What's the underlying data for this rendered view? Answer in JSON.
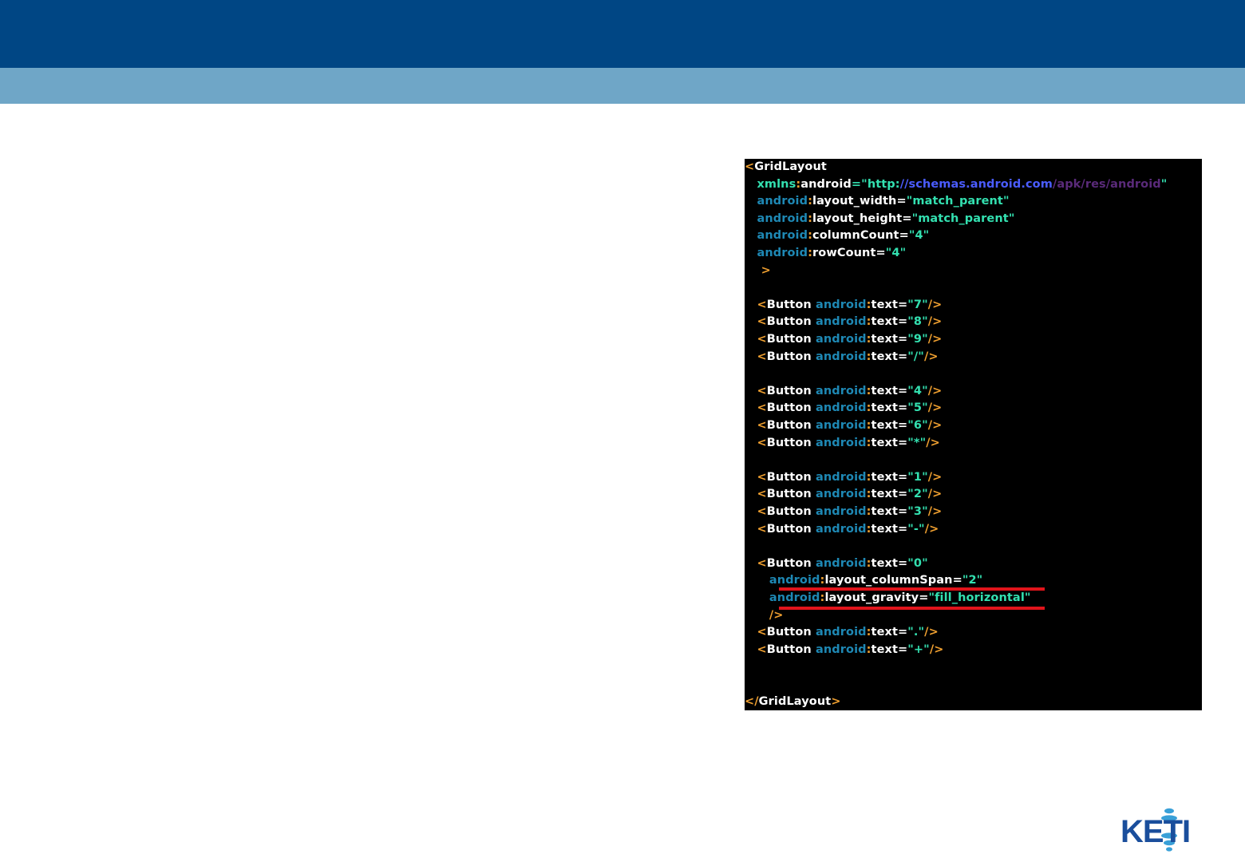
{
  "colors": {
    "header_band": "#004684",
    "sub_band": "#6fa6c7",
    "code_bg": "#000000",
    "tag_bracket": "#f0a030",
    "element_name": "#ffffff",
    "namespace": "#1e88b4",
    "attr_name": "#ffffff",
    "attr_value": "#33e0b0",
    "url_blue": "#4a5cff",
    "url_purple": "#5a2a7a",
    "highlight_underline": "#e0141b",
    "logo_blue": "#1a4e9c",
    "logo_light": "#39a0d8"
  },
  "code": {
    "lines": [
      [
        {
          "t": "<",
          "c": "tag_bracket"
        },
        {
          "t": "GridLayout",
          "c": "element_name"
        }
      ],
      [
        {
          "t": "   "
        },
        {
          "t": "xmlns",
          "c": "attr_value"
        },
        {
          "t": ":",
          "c": "tag_bracket"
        },
        {
          "t": "android",
          "c": "attr_name"
        },
        {
          "t": "=\"",
          "c": "attr_value"
        },
        {
          "t": "http:",
          "c": "attr_value"
        },
        {
          "t": "//schemas.android.com",
          "c": "url_blue"
        },
        {
          "t": "/apk/res/android",
          "c": "url_purple"
        },
        {
          "t": "\"",
          "c": "attr_value"
        }
      ],
      [
        {
          "t": "   "
        },
        {
          "t": "android",
          "c": "namespace"
        },
        {
          "t": ":",
          "c": "tag_bracket"
        },
        {
          "t": "layout_width",
          "c": "attr_name"
        },
        {
          "t": "=",
          "c": "attr_name"
        },
        {
          "t": "\"match_parent\"",
          "c": "attr_value"
        }
      ],
      [
        {
          "t": "   "
        },
        {
          "t": "android",
          "c": "namespace"
        },
        {
          "t": ":",
          "c": "tag_bracket"
        },
        {
          "t": "layout_height",
          "c": "attr_name"
        },
        {
          "t": "=",
          "c": "attr_name"
        },
        {
          "t": "\"match_parent\"",
          "c": "attr_value"
        }
      ],
      [
        {
          "t": "   "
        },
        {
          "t": "android",
          "c": "namespace"
        },
        {
          "t": ":",
          "c": "tag_bracket"
        },
        {
          "t": "columnCount",
          "c": "attr_name"
        },
        {
          "t": "=",
          "c": "attr_name"
        },
        {
          "t": "\"4\"",
          "c": "attr_value"
        }
      ],
      [
        {
          "t": "   "
        },
        {
          "t": "android",
          "c": "namespace"
        },
        {
          "t": ":",
          "c": "tag_bracket"
        },
        {
          "t": "rowCount",
          "c": "attr_name"
        },
        {
          "t": "=",
          "c": "attr_name"
        },
        {
          "t": "\"4\"",
          "c": "attr_value"
        }
      ],
      [
        {
          "t": "    "
        },
        {
          "t": ">",
          "c": "tag_bracket"
        }
      ],
      [],
      [
        {
          "t": "   "
        },
        {
          "t": "<",
          "c": "tag_bracket"
        },
        {
          "t": "Button ",
          "c": "element_name"
        },
        {
          "t": "android",
          "c": "namespace"
        },
        {
          "t": ":",
          "c": "tag_bracket"
        },
        {
          "t": "text",
          "c": "attr_name"
        },
        {
          "t": "=",
          "c": "attr_name"
        },
        {
          "t": "\"7\"",
          "c": "attr_value"
        },
        {
          "t": "/>",
          "c": "tag_bracket"
        }
      ],
      [
        {
          "t": "   "
        },
        {
          "t": "<",
          "c": "tag_bracket"
        },
        {
          "t": "Button ",
          "c": "element_name"
        },
        {
          "t": "android",
          "c": "namespace"
        },
        {
          "t": ":",
          "c": "tag_bracket"
        },
        {
          "t": "text",
          "c": "attr_name"
        },
        {
          "t": "=",
          "c": "attr_name"
        },
        {
          "t": "\"8\"",
          "c": "attr_value"
        },
        {
          "t": "/>",
          "c": "tag_bracket"
        }
      ],
      [
        {
          "t": "   "
        },
        {
          "t": "<",
          "c": "tag_bracket"
        },
        {
          "t": "Button ",
          "c": "element_name"
        },
        {
          "t": "android",
          "c": "namespace"
        },
        {
          "t": ":",
          "c": "tag_bracket"
        },
        {
          "t": "text",
          "c": "attr_name"
        },
        {
          "t": "=",
          "c": "attr_name"
        },
        {
          "t": "\"9\"",
          "c": "attr_value"
        },
        {
          "t": "/>",
          "c": "tag_bracket"
        }
      ],
      [
        {
          "t": "   "
        },
        {
          "t": "<",
          "c": "tag_bracket"
        },
        {
          "t": "Button ",
          "c": "element_name"
        },
        {
          "t": "android",
          "c": "namespace"
        },
        {
          "t": ":",
          "c": "tag_bracket"
        },
        {
          "t": "text",
          "c": "attr_name"
        },
        {
          "t": "=",
          "c": "attr_name"
        },
        {
          "t": "\"/\"",
          "c": "attr_value"
        },
        {
          "t": "/>",
          "c": "tag_bracket"
        }
      ],
      [],
      [
        {
          "t": "   "
        },
        {
          "t": "<",
          "c": "tag_bracket"
        },
        {
          "t": "Button ",
          "c": "element_name"
        },
        {
          "t": "android",
          "c": "namespace"
        },
        {
          "t": ":",
          "c": "tag_bracket"
        },
        {
          "t": "text",
          "c": "attr_name"
        },
        {
          "t": "=",
          "c": "attr_name"
        },
        {
          "t": "\"4\"",
          "c": "attr_value"
        },
        {
          "t": "/>",
          "c": "tag_bracket"
        }
      ],
      [
        {
          "t": "   "
        },
        {
          "t": "<",
          "c": "tag_bracket"
        },
        {
          "t": "Button ",
          "c": "element_name"
        },
        {
          "t": "android",
          "c": "namespace"
        },
        {
          "t": ":",
          "c": "tag_bracket"
        },
        {
          "t": "text",
          "c": "attr_name"
        },
        {
          "t": "=",
          "c": "attr_name"
        },
        {
          "t": "\"5\"",
          "c": "attr_value"
        },
        {
          "t": "/>",
          "c": "tag_bracket"
        }
      ],
      [
        {
          "t": "   "
        },
        {
          "t": "<",
          "c": "tag_bracket"
        },
        {
          "t": "Button ",
          "c": "element_name"
        },
        {
          "t": "android",
          "c": "namespace"
        },
        {
          "t": ":",
          "c": "tag_bracket"
        },
        {
          "t": "text",
          "c": "attr_name"
        },
        {
          "t": "=",
          "c": "attr_name"
        },
        {
          "t": "\"6\"",
          "c": "attr_value"
        },
        {
          "t": "/>",
          "c": "tag_bracket"
        }
      ],
      [
        {
          "t": "   "
        },
        {
          "t": "<",
          "c": "tag_bracket"
        },
        {
          "t": "Button ",
          "c": "element_name"
        },
        {
          "t": "android",
          "c": "namespace"
        },
        {
          "t": ":",
          "c": "tag_bracket"
        },
        {
          "t": "text",
          "c": "attr_name"
        },
        {
          "t": "=",
          "c": "attr_name"
        },
        {
          "t": "\"*\"",
          "c": "attr_value"
        },
        {
          "t": "/>",
          "c": "tag_bracket"
        }
      ],
      [],
      [
        {
          "t": "   "
        },
        {
          "t": "<",
          "c": "tag_bracket"
        },
        {
          "t": "Button ",
          "c": "element_name"
        },
        {
          "t": "android",
          "c": "namespace"
        },
        {
          "t": ":",
          "c": "tag_bracket"
        },
        {
          "t": "text",
          "c": "attr_name"
        },
        {
          "t": "=",
          "c": "attr_name"
        },
        {
          "t": "\"1\"",
          "c": "attr_value"
        },
        {
          "t": "/>",
          "c": "tag_bracket"
        }
      ],
      [
        {
          "t": "   "
        },
        {
          "t": "<",
          "c": "tag_bracket"
        },
        {
          "t": "Button ",
          "c": "element_name"
        },
        {
          "t": "android",
          "c": "namespace"
        },
        {
          "t": ":",
          "c": "tag_bracket"
        },
        {
          "t": "text",
          "c": "attr_name"
        },
        {
          "t": "=",
          "c": "attr_name"
        },
        {
          "t": "\"2\"",
          "c": "attr_value"
        },
        {
          "t": "/>",
          "c": "tag_bracket"
        }
      ],
      [
        {
          "t": "   "
        },
        {
          "t": "<",
          "c": "tag_bracket"
        },
        {
          "t": "Button ",
          "c": "element_name"
        },
        {
          "t": "android",
          "c": "namespace"
        },
        {
          "t": ":",
          "c": "tag_bracket"
        },
        {
          "t": "text",
          "c": "attr_name"
        },
        {
          "t": "=",
          "c": "attr_name"
        },
        {
          "t": "\"3\"",
          "c": "attr_value"
        },
        {
          "t": "/>",
          "c": "tag_bracket"
        }
      ],
      [
        {
          "t": "   "
        },
        {
          "t": "<",
          "c": "tag_bracket"
        },
        {
          "t": "Button ",
          "c": "element_name"
        },
        {
          "t": "android",
          "c": "namespace"
        },
        {
          "t": ":",
          "c": "tag_bracket"
        },
        {
          "t": "text",
          "c": "attr_name"
        },
        {
          "t": "=",
          "c": "attr_name"
        },
        {
          "t": "\"-\"",
          "c": "attr_value"
        },
        {
          "t": "/>",
          "c": "tag_bracket"
        }
      ],
      [],
      [
        {
          "t": "   "
        },
        {
          "t": "<",
          "c": "tag_bracket"
        },
        {
          "t": "Button ",
          "c": "element_name"
        },
        {
          "t": "android",
          "c": "namespace"
        },
        {
          "t": ":",
          "c": "tag_bracket"
        },
        {
          "t": "text",
          "c": "attr_name"
        },
        {
          "t": "=",
          "c": "attr_name"
        },
        {
          "t": "\"0\"",
          "c": "attr_value"
        }
      ],
      [
        {
          "t": "      "
        },
        {
          "t": "android",
          "c": "namespace"
        },
        {
          "t": ":",
          "c": "tag_bracket"
        },
        {
          "t": "layout_columnSpan",
          "c": "attr_name"
        },
        {
          "t": "=",
          "c": "attr_name"
        },
        {
          "t": "\"2\"",
          "c": "attr_value"
        }
      ],
      [
        {
          "t": "      "
        },
        {
          "t": "android",
          "c": "namespace"
        },
        {
          "t": ":",
          "c": "tag_bracket"
        },
        {
          "t": "layout_gravity",
          "c": "attr_name"
        },
        {
          "t": "=",
          "c": "attr_name"
        },
        {
          "t": "\"fill_horizontal\"",
          "c": "attr_value"
        }
      ],
      [
        {
          "t": "      "
        },
        {
          "t": "/>",
          "c": "tag_bracket"
        }
      ],
      [
        {
          "t": "   "
        },
        {
          "t": "<",
          "c": "tag_bracket"
        },
        {
          "t": "Button ",
          "c": "element_name"
        },
        {
          "t": "android",
          "c": "namespace"
        },
        {
          "t": ":",
          "c": "tag_bracket"
        },
        {
          "t": "text",
          "c": "attr_name"
        },
        {
          "t": "=",
          "c": "attr_name"
        },
        {
          "t": "\".\"",
          "c": "attr_value"
        },
        {
          "t": "/>",
          "c": "tag_bracket"
        }
      ],
      [
        {
          "t": "   "
        },
        {
          "t": "<",
          "c": "tag_bracket"
        },
        {
          "t": "Button ",
          "c": "element_name"
        },
        {
          "t": "android",
          "c": "namespace"
        },
        {
          "t": ":",
          "c": "tag_bracket"
        },
        {
          "t": "text",
          "c": "attr_name"
        },
        {
          "t": "=",
          "c": "attr_name"
        },
        {
          "t": "\"+\"",
          "c": "attr_value"
        },
        {
          "t": "/>",
          "c": "tag_bracket"
        }
      ],
      [],
      [],
      [
        {
          "t": "</",
          "c": "tag_bracket"
        },
        {
          "t": "GridLayout",
          "c": "element_name"
        },
        {
          "t": ">",
          "c": "tag_bracket"
        }
      ]
    ]
  },
  "logo": {
    "text": "KETI"
  }
}
